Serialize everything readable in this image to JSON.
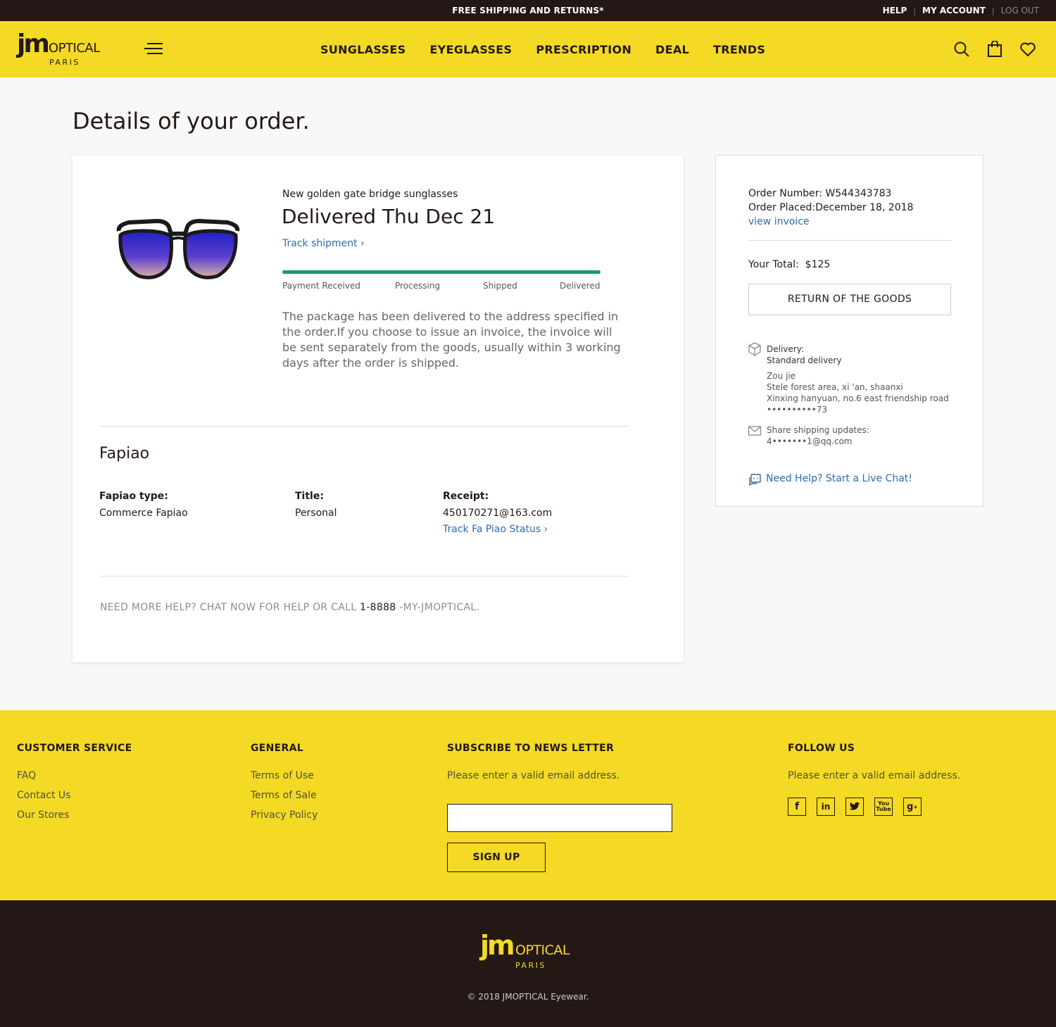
{
  "topbar": {
    "promo": "FREE SHIPPING AND RETURNS*",
    "help": "HELP",
    "my_account": "MY ACCOUNT",
    "log_out": "LOG OUT"
  },
  "header": {
    "logo_jm": "jm",
    "logo_optical": "OPTICAL",
    "logo_paris": "PARIS",
    "nav": [
      "SUNGLASSES",
      "EYEGLASSES",
      "PRESCRIPTION",
      "DEAL",
      "TRENDS"
    ],
    "icons": [
      "search-icon",
      "bag-icon",
      "heart-icon"
    ]
  },
  "main": {
    "title": "Details of your order.",
    "product_name": "New golden gate bridge sunglasses",
    "status": "Delivered Thu Dec 21",
    "track_link": "Track shipment ›",
    "progress_fraction": 1.0,
    "steps": [
      "Payment Received",
      "Processing",
      "Shipped",
      "Delivered"
    ],
    "description": "The package has been delivered to the address specified in the order.If you choose to issue an invoice, the invoice will be sent separately from the goods, usually within 3 working days after the order is shipped.",
    "fapiao": {
      "heading": "Fapiao",
      "type_label": "Fapiao type:",
      "type_value": "Commerce Fapiao",
      "title_label": "Title:",
      "title_value": "Personal",
      "receipt_label": "Receipt:",
      "receipt_value": "450170271@163.com",
      "track_link": "Track Fa Piao Status ›"
    },
    "help_prefix": "NEED MORE HELP? CHAT NOW FOR HELP OR CALL ",
    "help_phone": "1-8888",
    "help_suffix": " -MY-JMOPTICAL."
  },
  "summary": {
    "order_number_label": "Order Number:",
    "order_number": "W544343783",
    "order_placed_label": "Order Placed:",
    "order_placed": "December 18, 2018",
    "view_invoice": "view invoice",
    "total_label": "Your Total:",
    "total": "$125",
    "return_button": "RETURN OF THE GOODS",
    "delivery_label": "Delivery:",
    "delivery_method": "Standard delivery",
    "recipient": "Zou jie",
    "address_line1": "Stele forest area, xi 'an, shaanxi",
    "address_line2": "Xinxing hanyuan, no.6 east friendship road",
    "phone": "••••••••••73",
    "share_label": "Share shipping updates:",
    "share_email": "4•••••••1@qq.com",
    "chat_link": "Need Help? Start a Live Chat!"
  },
  "footer": {
    "customer_service": {
      "heading": "CUSTOMER SERVICE",
      "links": [
        "FAQ",
        "Contact Us",
        "Our Stores"
      ]
    },
    "general": {
      "heading": "GENERAL",
      "links": [
        "Terms of Use",
        "Terms of Sale",
        "Privacy Policy"
      ]
    },
    "subscribe": {
      "heading": "SUBSCRIBE TO NEWS LETTER",
      "note": "Please enter a valid email address.",
      "button": "SIGN UP"
    },
    "follow": {
      "heading": "FOLLOW US",
      "note": "Please enter a valid email address.",
      "icons": [
        "facebook-icon",
        "linkedin-icon",
        "twitter-icon",
        "youtube-icon",
        "google-plus-icon"
      ]
    },
    "copyright": "© 2018 JMOPTICAL Eyewear."
  },
  "colors": {
    "brand_yellow": "#f4da24",
    "dark": "#231815",
    "link_blue": "#2b6cb0",
    "progress_green": "#1d9a6c"
  }
}
